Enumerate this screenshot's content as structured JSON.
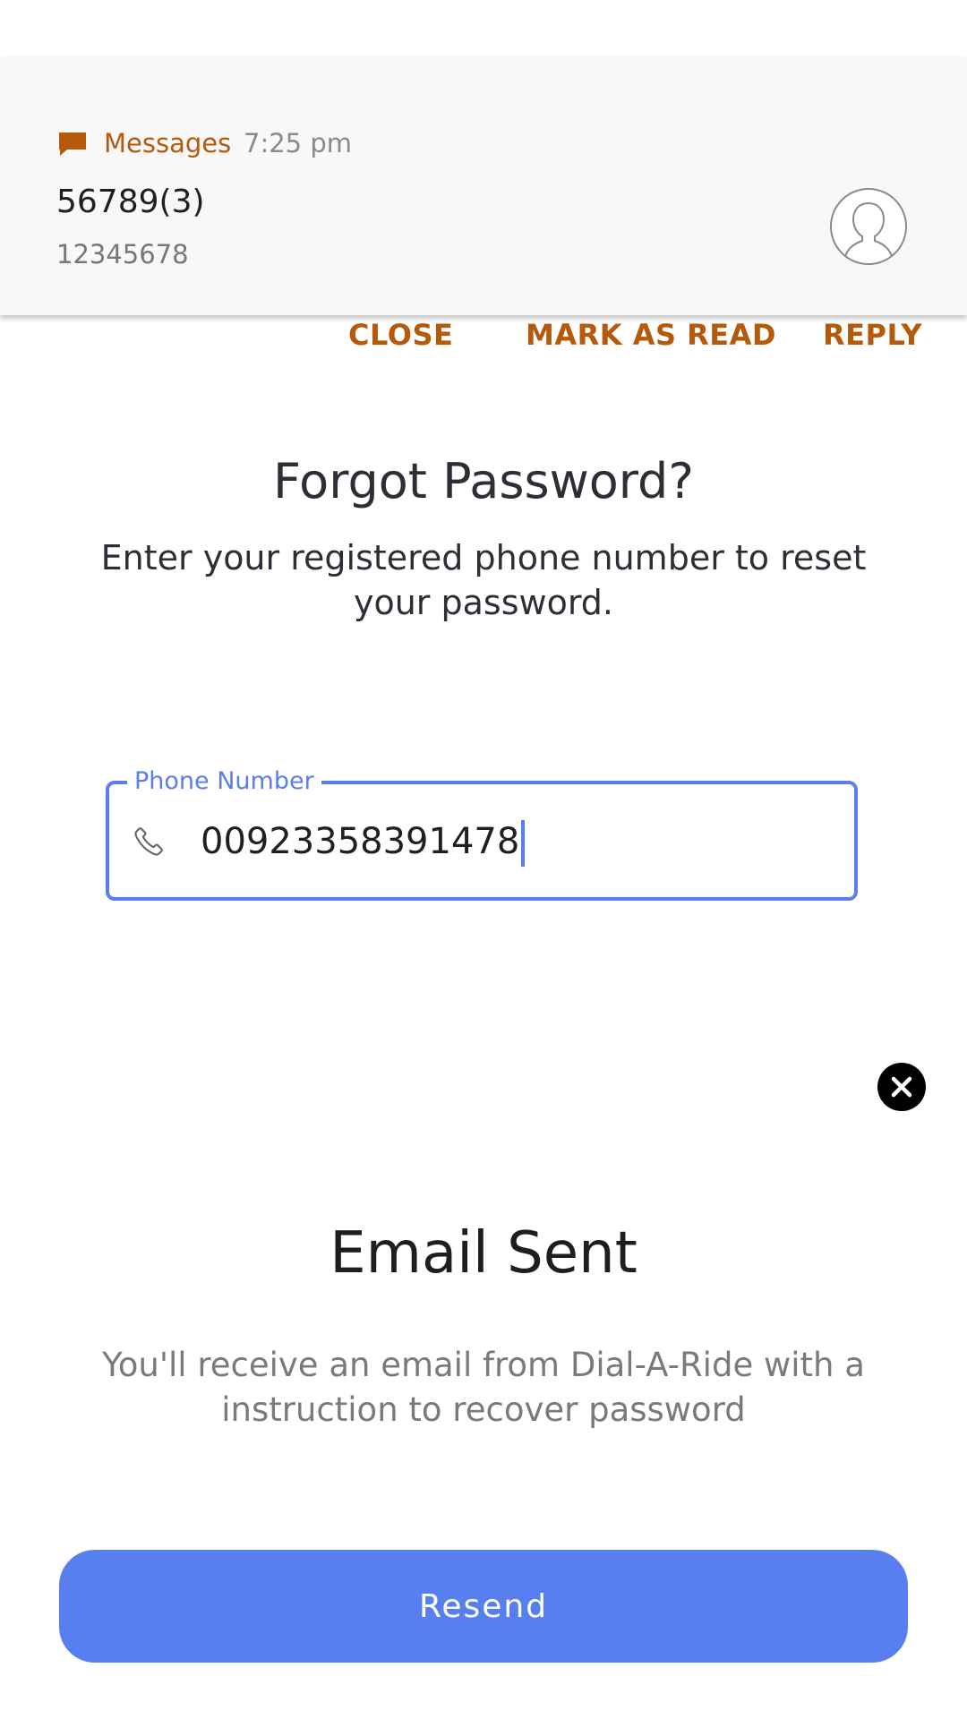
{
  "notification": {
    "app_name": "Messages",
    "time": "7:25 pm",
    "title": "56789(3)",
    "body": "12345678",
    "actions": {
      "close": "CLOSE",
      "mark_as_read": "MARK AS READ",
      "reply": "REPLY"
    },
    "accent_color": "#b45a0a",
    "app_icon": "message-bubble-icon",
    "avatar_icon": "default-avatar-icon"
  },
  "forgot_password": {
    "title": "Forgot Password?",
    "subtitle": "Enter your registered phone number to reset your password.",
    "phone_field": {
      "label": "Phone Number",
      "value": "00923358391478",
      "icon": "phone-icon"
    }
  },
  "email_sent": {
    "title": "Email Sent",
    "description": "You'll receive an email from Dial-A-Ride with a instruction to recover password",
    "resend_label": "Resend",
    "close_icon": "close-icon",
    "button_color": "#587ff0"
  }
}
